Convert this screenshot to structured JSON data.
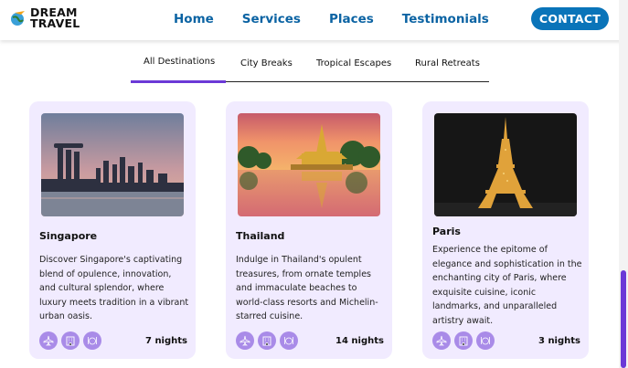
{
  "brand": {
    "line1": "DREAM",
    "line2": "TRAVEL"
  },
  "nav": {
    "items": [
      "Home",
      "Services",
      "Places",
      "Testimonials"
    ],
    "contact": "CONTACT"
  },
  "tabs": [
    "All Destinations",
    "City Breaks",
    "Tropical Escapes",
    "Rural Retreats"
  ],
  "active_tab": "All Destinations",
  "cards": [
    {
      "title": "Singapore",
      "description": "Discover Singapore's captivating blend of opulence, innovation, and cultural splendor, where luxury meets tradition in a vibrant urban oasis.",
      "nights": "7 nights",
      "image": "singapore-marina-bay-skyline"
    },
    {
      "title": "Thailand",
      "description": "Indulge in Thailand's opulent treasures, from ornate temples and immaculate beaches to world-class resorts and Michelin-starred cuisine.",
      "nights": "14 nights",
      "image": "thai-golden-temple-by-lake"
    },
    {
      "title": "Paris",
      "description": "Experience the epitome of elegance and sophistication in the enchanting city of Paris, where exquisite cuisine, iconic landmarks, and unparalleled artistry await.",
      "nights": "3 nights",
      "image": "eiffel-tower-at-night"
    }
  ],
  "amenity_icons": [
    "plane-icon",
    "hotel-icon",
    "meal-icon"
  ],
  "colors": {
    "brand_blue": "#0b63a3",
    "contact_bg": "#0a74b9",
    "accent_purple": "#6b39d7",
    "card_bg": "#f1ebff",
    "icon_bg": "#a98be8"
  }
}
